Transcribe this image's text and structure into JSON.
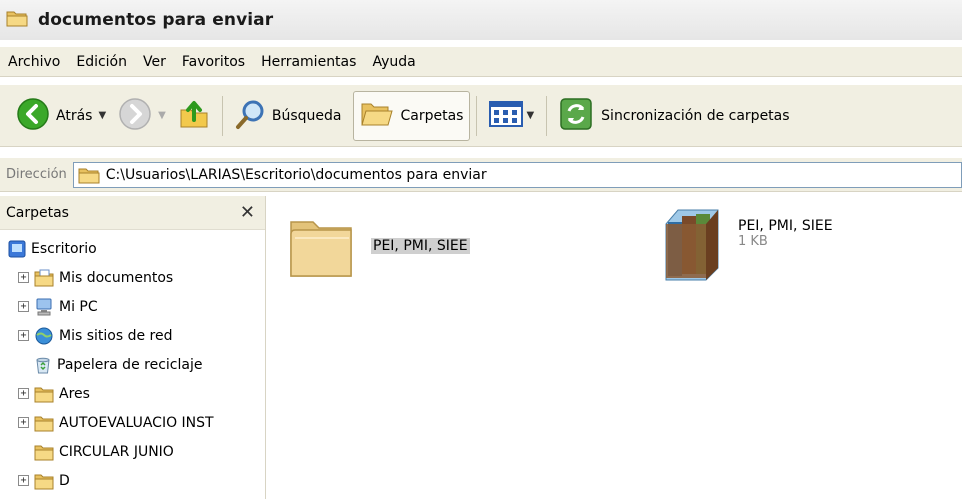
{
  "window": {
    "title": "documentos para enviar"
  },
  "menu": [
    "Archivo",
    "Edición",
    "Ver",
    "Favoritos",
    "Herramientas",
    "Ayuda"
  ],
  "toolbar": {
    "back_label": "Atrás",
    "search_label": "Búsqueda",
    "folders_label": "Carpetas",
    "sync_label": "Sincronización de carpetas"
  },
  "address": {
    "label": "Dirección",
    "path": "C:\\Usuarios\\LARIAS\\Escritorio\\documentos para enviar"
  },
  "folders_pane": {
    "title": "Carpetas",
    "close_glyph": "✕",
    "items": [
      {
        "label": "Escritorio"
      },
      {
        "label": "Mis documentos"
      },
      {
        "label": "Mi PC"
      },
      {
        "label": "Mis sitios de red"
      },
      {
        "label": "Papelera de reciclaje"
      },
      {
        "label": "Ares"
      },
      {
        "label": "AUTOEVALUACIO INST"
      },
      {
        "label": "CIRCULAR JUNIO"
      },
      {
        "label": "D"
      }
    ]
  },
  "files": [
    {
      "name": "PEI, PMI, SIEE",
      "type": "folder",
      "selected": true
    },
    {
      "name": "PEI, PMI, SIEE",
      "type": "winrar-archive",
      "size": "1 KB"
    }
  ],
  "colors": {
    "chrome_bg": "#f1efe2",
    "folder_yellow": "#f2d374",
    "selection": "#cfcfcf",
    "back_green": "#3ba829",
    "address_border": "#7f9db9"
  }
}
